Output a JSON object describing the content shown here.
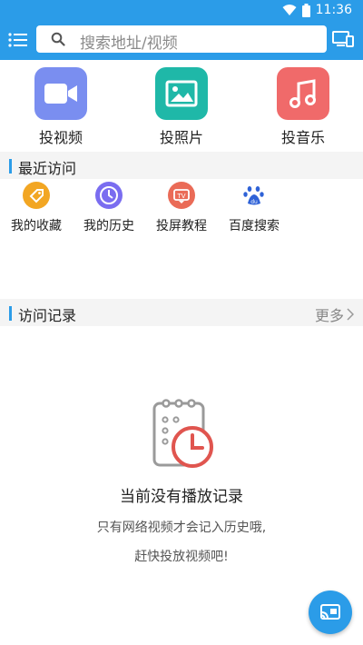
{
  "status": {
    "time": "11:36"
  },
  "header": {
    "search_placeholder": "搜索地址/视频"
  },
  "tiles": [
    {
      "label": "投视频",
      "icon": "video-camera-icon",
      "color": "#7a8ef0"
    },
    {
      "label": "投照片",
      "icon": "image-icon",
      "color": "#1fb8a8"
    },
    {
      "label": "投音乐",
      "icon": "music-note-icon",
      "color": "#f06a6a"
    }
  ],
  "recent_section": {
    "title": "最近访问"
  },
  "recent_items": [
    {
      "label": "我的收藏",
      "icon": "tag-icon",
      "color": "#f2a623"
    },
    {
      "label": "我的历史",
      "icon": "clock-icon",
      "color": "#7a6df0"
    },
    {
      "label": "投屏教程",
      "icon": "tv-icon",
      "color": "#ea6b57"
    },
    {
      "label": "百度搜索",
      "icon": "baidu-paw-icon",
      "color": "#2f62d7"
    }
  ],
  "history_section": {
    "title": "访问记录",
    "more_label": "更多"
  },
  "empty_state": {
    "title": "当前没有播放记录",
    "line1": "只有网络视频才会记入历史哦,",
    "line2": "赶快投放视频吧!"
  },
  "colors": {
    "primary": "#2b9ce8",
    "section_bg": "#f4f4f4",
    "empty_icon_red": "#e0554f"
  }
}
